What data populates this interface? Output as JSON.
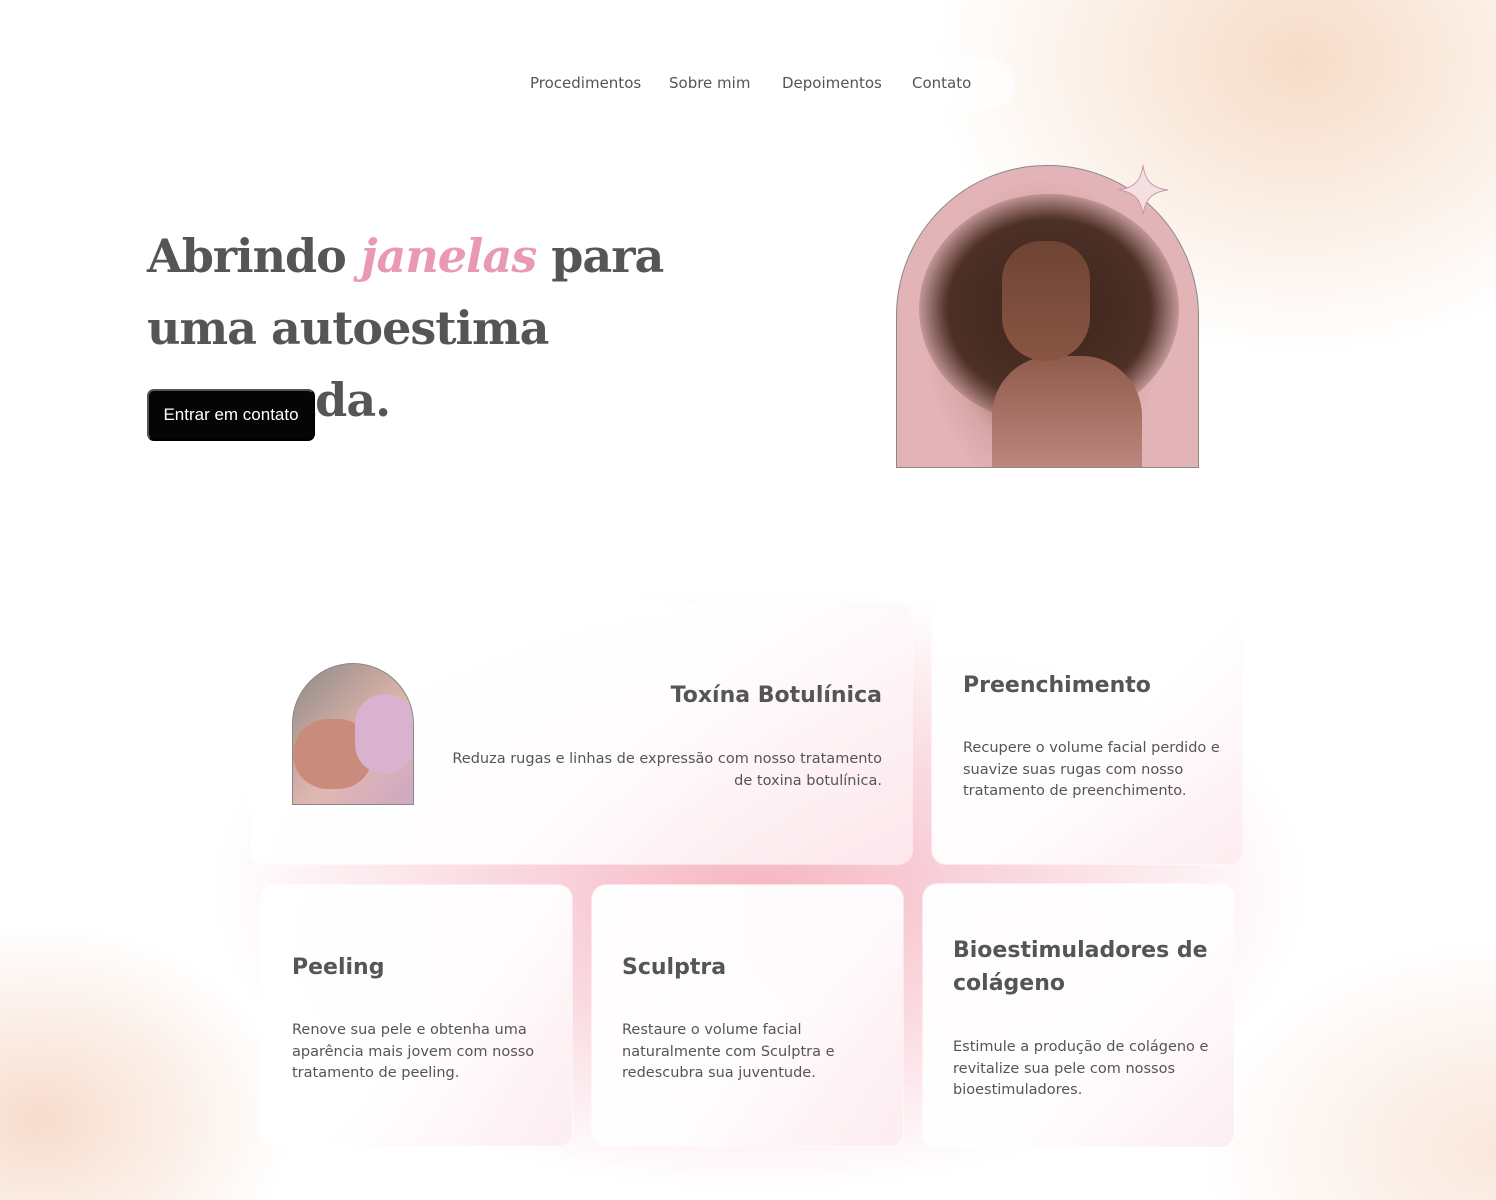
{
  "nav": {
    "items": [
      {
        "label": "Procedimentos"
      },
      {
        "label": "Sobre mim"
      },
      {
        "label": "Depoimentos"
      },
      {
        "label": "Contato"
      }
    ]
  },
  "hero": {
    "title_before": "Abrindo ",
    "title_accent": "janelas",
    "title_after": " para uma autoestima renovada.",
    "cta_label": "Entrar em contato",
    "accent_color": "#e999b5",
    "cta_color": "#050505"
  },
  "cards": [
    {
      "title": "Toxína Botulínica",
      "description": "Reduza rugas e linhas de expressão com nosso tratamento de toxina botulínica."
    },
    {
      "title": "Preenchimento",
      "description": "Recupere o volume facial perdido e suavize suas rugas com nosso tratamento de preenchimento."
    },
    {
      "title": "Peeling",
      "description": "Renove sua pele e obtenha uma aparência mais jovem com nosso tratamento de peeling."
    },
    {
      "title": "Sculptra",
      "description": "Restaure o volume facial naturalmente com Sculptra e redescubra sua juventude."
    },
    {
      "title": "Bioestimuladores de colágeno",
      "description": "Estimule a produção de colágeno e revitalize sua pele com nossos bioestimuladores."
    }
  ],
  "icons": {
    "sparkle": "sparkle-icon"
  }
}
